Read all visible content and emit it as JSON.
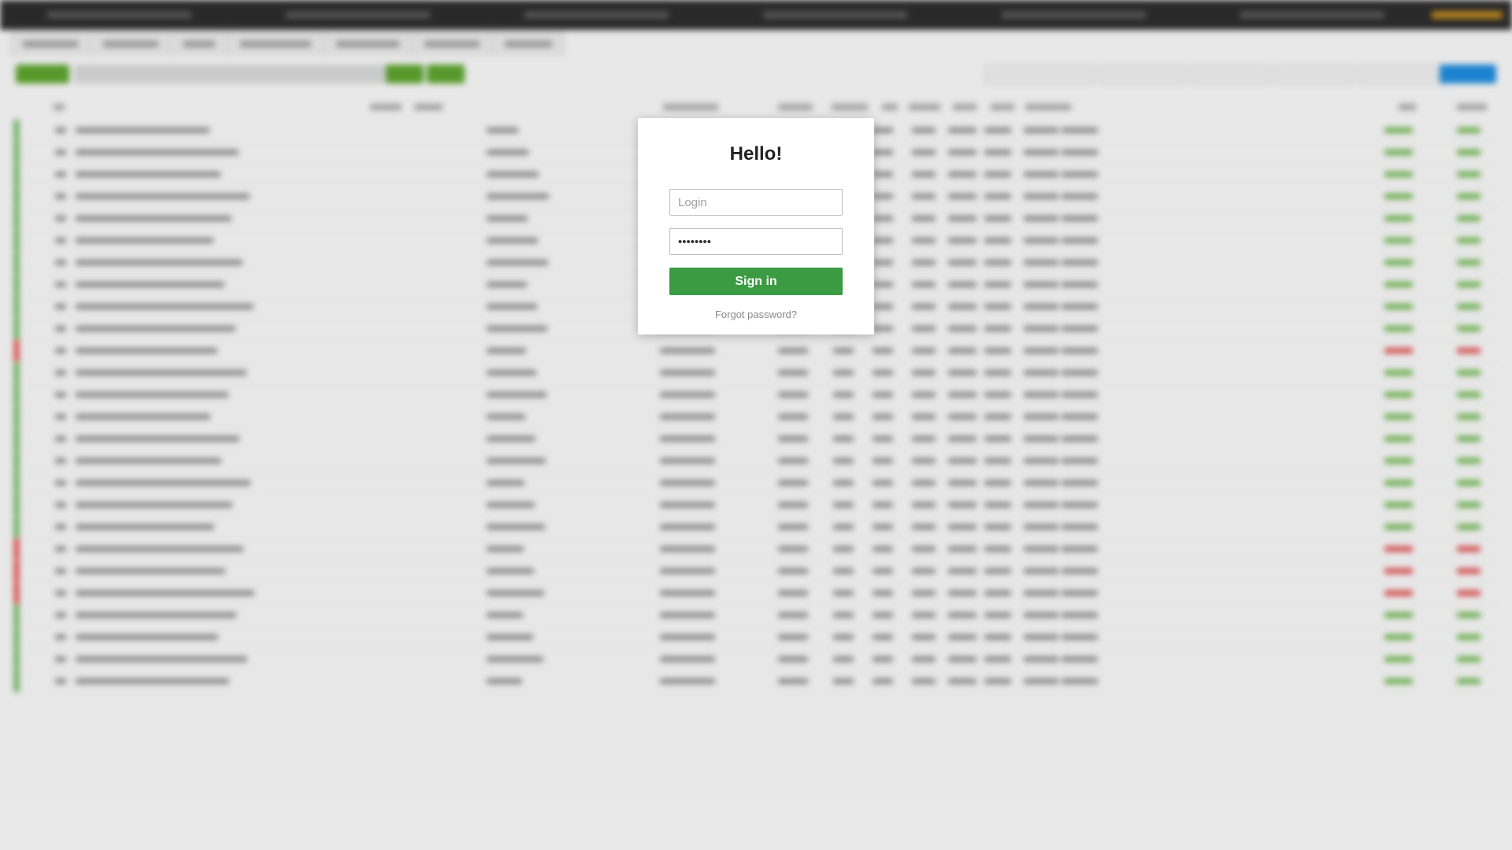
{
  "login_modal": {
    "title": "Hello!",
    "login_placeholder": "Login",
    "password_value": "••••••••",
    "signin_label": "Sign in",
    "forgot_label": "Forgot password?"
  },
  "colors": {
    "primary_green": "#3a9b43",
    "status_green": "#55aa44",
    "status_red": "#dd3333",
    "accent_blue": "#1e88d8",
    "topbar_bg": "#2b2b2b"
  }
}
